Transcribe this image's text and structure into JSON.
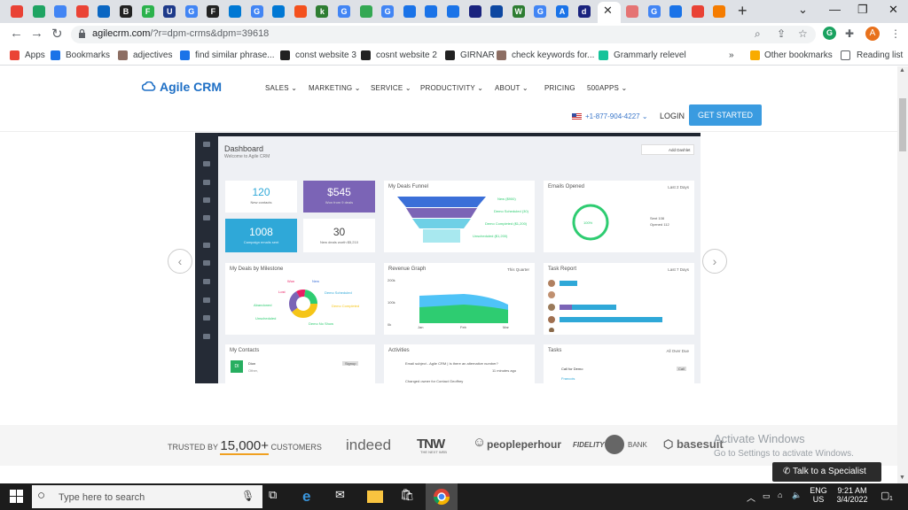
{
  "browser": {
    "tabs": [
      {
        "icon": "chrome-icon",
        "color": "#e94235"
      },
      {
        "icon": "drive-icon",
        "color": "#1fa463"
      },
      {
        "icon": "docs-icon",
        "color": "#4285f4"
      },
      {
        "icon": "app-icon",
        "color": "#ea4335"
      },
      {
        "icon": "mail-icon",
        "color": "#0a66c2"
      },
      {
        "icon": "b-icon",
        "color": "#222222"
      },
      {
        "icon": "f-icon",
        "color": "#2bb24c"
      },
      {
        "icon": "usn-icon",
        "color": "#1e3a8a"
      },
      {
        "icon": "google-icon",
        "color": "#4285f4"
      },
      {
        "icon": "f-icon",
        "color": "#222222"
      },
      {
        "icon": "cloud-icon",
        "color": "#0078d4"
      },
      {
        "icon": "google-icon",
        "color": "#4285f4"
      },
      {
        "icon": "cloud-icon",
        "color": "#0078d4"
      },
      {
        "icon": "play-icon",
        "color": "#f4511e"
      },
      {
        "icon": "k-icon",
        "color": "#2e7d32"
      },
      {
        "icon": "google-icon",
        "color": "#4285f4"
      },
      {
        "icon": "globe-icon",
        "color": "#34a853"
      },
      {
        "icon": "google-icon",
        "color": "#4285f4"
      },
      {
        "icon": "cloud-icon",
        "color": "#1a73e8"
      },
      {
        "icon": "doc-icon",
        "color": "#1a73e8"
      },
      {
        "icon": "cloud-icon",
        "color": "#1a73e8"
      },
      {
        "icon": "moon-icon",
        "color": "#1a237e"
      },
      {
        "icon": "arrow-icon",
        "color": "#0d47a1"
      },
      {
        "icon": "w-icon",
        "color": "#2e7d32"
      },
      {
        "icon": "google-icon",
        "color": "#4285f4"
      },
      {
        "icon": "a-icon",
        "color": "#1a73e8"
      },
      {
        "icon": "dpm-icon",
        "color": "#1a237e"
      }
    ],
    "tabs_after_active": [
      {
        "icon": "square-icon",
        "color": "#e57373"
      },
      {
        "icon": "google-icon",
        "color": "#4285f4"
      },
      {
        "icon": "cloud-icon",
        "color": "#1a73e8"
      },
      {
        "icon": "chrome-icon",
        "color": "#e94235"
      },
      {
        "icon": "gear-icon",
        "color": "#f57c00"
      }
    ],
    "url_host": "agilecrm.com",
    "url_path": "/?r=dpm-crms&dpm=39618",
    "profile_initial": "A",
    "extension_initial": "G",
    "bookmarks": [
      {
        "label": "Apps",
        "color": "#ea4335"
      },
      {
        "label": "Bookmarks",
        "color": "#1a73e8"
      },
      {
        "label": "adjectives",
        "color": "#8d6e63"
      },
      {
        "label": "find similar phrase...",
        "color": "#1a73e8"
      },
      {
        "label": "const website 3",
        "color": "#222222",
        "prefix": "dcf"
      },
      {
        "label": "cosnt website 2",
        "color": "#222222",
        "prefix": "M"
      },
      {
        "label": "GIRNAR",
        "color": "#222222",
        "prefix": "WiX"
      },
      {
        "label": "check keywords for...",
        "color": "#8d6e63"
      },
      {
        "label": "Grammarly relevel",
        "color": "#15c39a"
      }
    ],
    "bookmarks_overflow": "»",
    "other_bookmarks": "Other bookmarks",
    "reading_list": "Reading list"
  },
  "site": {
    "logo_text": "Agile CRM",
    "nav": [
      "SALES",
      "MARKETING",
      "SERVICE",
      "PRODUCTIVITY",
      "ABOUT",
      "PRICING",
      "500APPS"
    ],
    "nav_has_caret": [
      true,
      true,
      true,
      true,
      true,
      false,
      true
    ],
    "phone": "+1-877-904-4227",
    "login": "LOGIN",
    "cta": "GET STARTED"
  },
  "dashboard": {
    "title": "Dashboard",
    "subtitle": "Welcome to Agile CRM",
    "add_dashlet": "Add Dashlet",
    "stats": [
      {
        "value": "120",
        "label": "New contacts"
      },
      {
        "value": "$545",
        "label": "Won from 9 deals"
      },
      {
        "value": "1008",
        "label": "Campaign emails sent"
      },
      {
        "value": "30",
        "label": "New deals worth $5,210"
      }
    ],
    "funnel_title": "My Deals Funnel",
    "funnel_labels": [
      "New ($900)",
      "Demo Scheduled (30)",
      "Demo Completed ($1,200)",
      "Unscheduled ($1,200)"
    ],
    "emails_title": "Emails Opened",
    "emails_range": "Last 2 Days",
    "emails_center": "100%",
    "emails_legend": [
      "Sent 108",
      "Opened 112"
    ],
    "milestone_title": "My Deals by Milestone",
    "milestone_labels": [
      "Won",
      "New",
      "Lost",
      "Demo Scheduled",
      "Abandoned",
      "Demo Completed",
      "Unscheduled",
      "Demo No Show"
    ],
    "revenue_title": "Revenue Graph",
    "revenue_range": "This Quarter",
    "revenue_y": [
      "200k",
      "100k",
      "0k"
    ],
    "revenue_x": [
      "Jan",
      "Feb",
      "Mar"
    ],
    "task_title": "Task Report",
    "task_range": "Last 7 Days",
    "contacts_title": "My Contacts",
    "contact_initials": "DI",
    "contact_name": "Dion",
    "contact_sub": "Other,",
    "contact_tag": "Signup",
    "activities_title": "Activities",
    "activity_1": "Email subject - Agile CRM | Is there an alternative number?",
    "activity_1_time": "11 minutes ago",
    "activity_2": "Changed owner for Contact Geoffrey",
    "tasks_title": "Tasks",
    "tasks_range": "All Over Due",
    "task_item": "Call for Demo",
    "task_person": "Francois",
    "task_tag": "Call",
    "colors": {
      "sidebar": "#252b36",
      "blue": "#2fa8d8",
      "purple": "#7b64b6",
      "green": "#2ecc71",
      "cyan": "#4fd1e0"
    }
  },
  "trusted": {
    "prefix": "TRUSTED BY",
    "count": "15,000+",
    "suffix": "CUSTOMERS",
    "brands": [
      "indeed",
      "TNW",
      "peopleperhour",
      "FIDELITY",
      "BANK",
      "basesuit"
    ],
    "tnw_sub": "THE NEXT WEB"
  },
  "windows_activation": {
    "line1": "Activate Windows",
    "line2": "Go to Settings to activate Windows."
  },
  "specialist": "Talk to a Specialist",
  "taskbar": {
    "search_placeholder": "Type here to search",
    "lang_1": "ENG",
    "lang_2": "US",
    "time": "9:21 AM",
    "date": "3/4/2022",
    "notif_count": "1"
  }
}
